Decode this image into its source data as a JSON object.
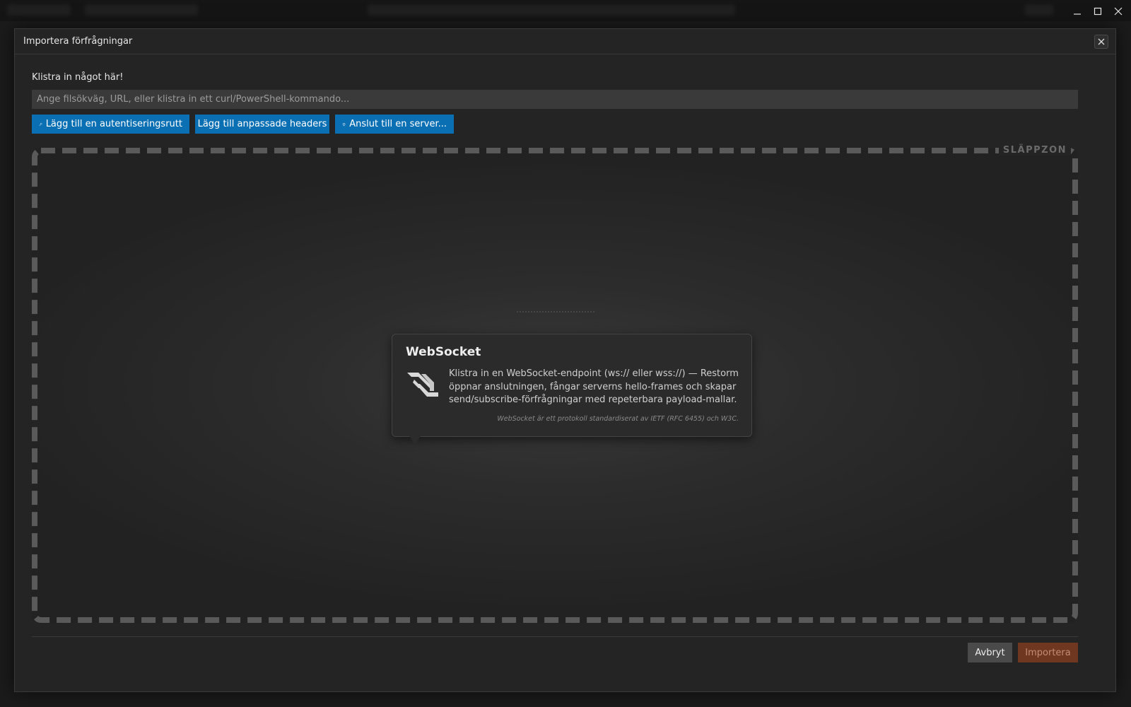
{
  "window": {
    "minimize_icon": "minimize-icon",
    "maximize_icon": "maximize-icon",
    "close_icon": "close-icon"
  },
  "dialog": {
    "title": "Importera förfrågningar",
    "close_icon": "close-icon",
    "paste_label": "Klistra in något här!",
    "input": {
      "value": "",
      "placeholder": "Ange filsökväg, URL, eller klistra in ett curl/PowerShell-kommando..."
    },
    "buttons": {
      "auth": {
        "label": "Lägg till en autentiseringsrutt",
        "icon": "key-icon"
      },
      "headers": {
        "label": "Lägg till anpassade headers"
      },
      "server": {
        "label": "Anslut till en server...",
        "icon": "plug-icon"
      }
    },
    "dropzone": {
      "label": "SLÄPPZON",
      "tooltip": {
        "title": "WebSocket",
        "icon": "websocket-icon",
        "body": "Klistra in en WebSocket-endpoint (ws:// eller wss://) — Restorm öppnar anslutningen, fångar serverns hello-frames och skapar send/subscribe-förfrågningar med repeterbara payload-mallar.",
        "note": "WebSocket är ett protokoll standardiserat av IETF (RFC 6455) och W3C."
      }
    },
    "footer": {
      "cancel_label": "Avbryt",
      "import_label": "Importera"
    }
  },
  "colors": {
    "accent_blue": "#0b6fb3",
    "import_button": "#6f3620",
    "dialog_bg": "#242424"
  }
}
